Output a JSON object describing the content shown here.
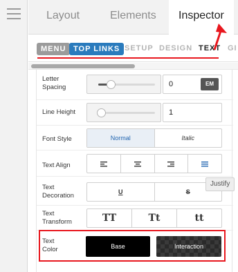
{
  "main_tabs": [
    {
      "label": "Layout",
      "active": false
    },
    {
      "label": "Elements",
      "active": false
    },
    {
      "label": "Inspector",
      "active": true
    }
  ],
  "sub_tabs": [
    {
      "label": "MENU",
      "style": "pill",
      "color": "#9b9b9b"
    },
    {
      "label": "TOP LINKS",
      "style": "pill",
      "color": "#2a7bbd"
    },
    {
      "label": "SETUP"
    },
    {
      "label": "DESIGN"
    },
    {
      "label": "TEXT",
      "active": true
    },
    {
      "label": "GI"
    }
  ],
  "colors": {
    "annotation": "#e8171e",
    "selected_blue": "#1f64b0",
    "pill_gray": "#9b9b9b",
    "pill_blue": "#2a7bbd"
  },
  "letter_spacing": {
    "label": "Letter\nSpacing",
    "value": "0",
    "unit": "EM",
    "slider_level": 0.2
  },
  "line_height": {
    "label": "Line Height",
    "value": "1",
    "slider_level": 0.05
  },
  "font_style": {
    "label": "Font Style",
    "options": [
      "Normal",
      "Italic"
    ],
    "selected": "Normal"
  },
  "text_align": {
    "label": "Text Align",
    "icons": [
      "align-left-icon",
      "align-center-icon",
      "align-right-icon",
      "align-justify-icon"
    ],
    "selected": "align-justify-icon",
    "tooltip": "Justify"
  },
  "text_decoration": {
    "label": "Text\nDecoration",
    "options": [
      "U",
      "S"
    ],
    "icons": [
      "underline-icon",
      "strikethrough-icon"
    ]
  },
  "text_transform": {
    "label": "Text\nTransform",
    "options": [
      "TT",
      "Tt",
      "tt"
    ]
  },
  "text_color": {
    "label": "Text\nColor",
    "base_label": "Base",
    "interaction_label": "Interaction",
    "base_color": "#000000"
  }
}
